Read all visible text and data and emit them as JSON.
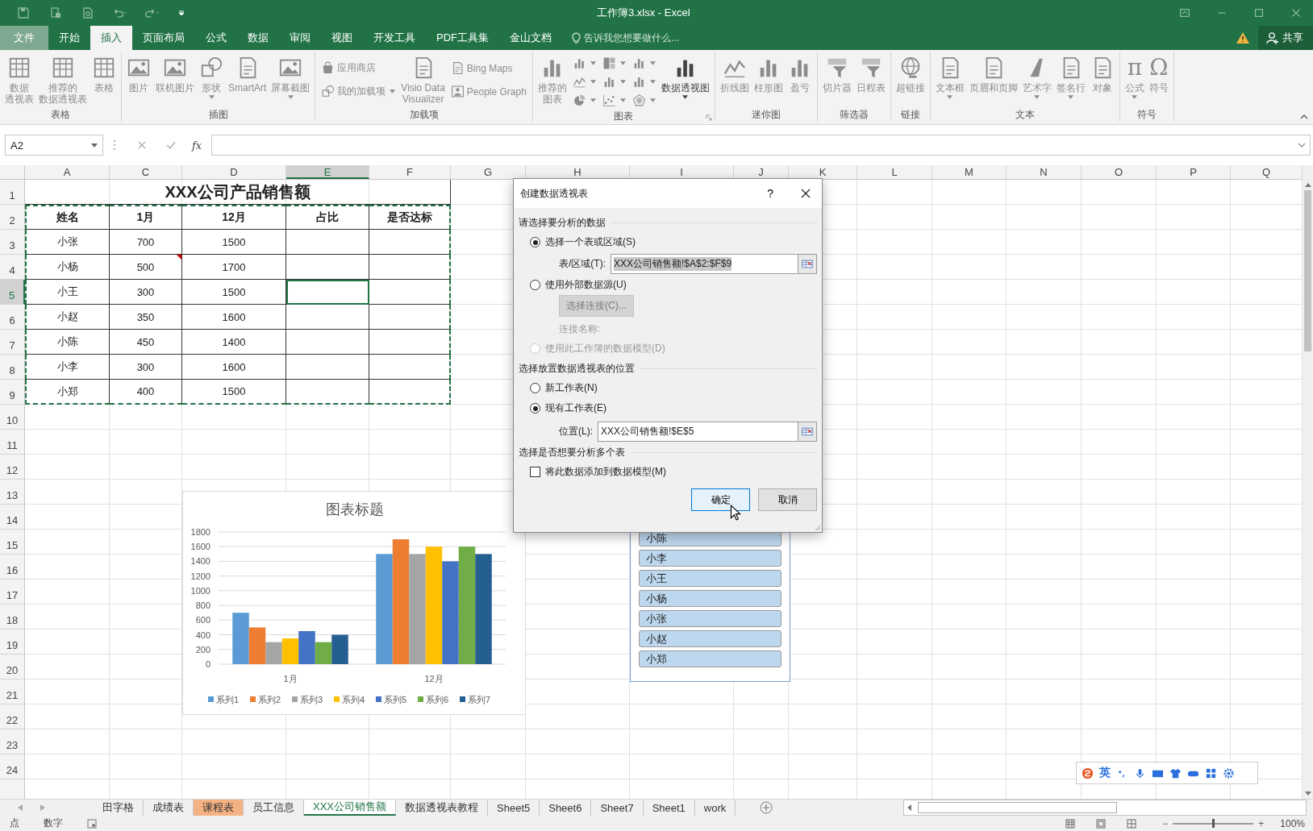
{
  "window": {
    "title": "工作簿3.xlsx - Excel"
  },
  "ribbon_tabs": [
    {
      "label": "文件",
      "kind": "file",
      "selected": false
    },
    {
      "label": "开始",
      "kind": "tab",
      "selected": false
    },
    {
      "label": "插入",
      "kind": "tab",
      "selected": true
    },
    {
      "label": "页面布局",
      "kind": "tab",
      "selected": false
    },
    {
      "label": "公式",
      "kind": "tab",
      "selected": false
    },
    {
      "label": "数据",
      "kind": "tab",
      "selected": false
    },
    {
      "label": "审阅",
      "kind": "tab",
      "selected": false
    },
    {
      "label": "视图",
      "kind": "tab",
      "selected": false
    },
    {
      "label": "开发工具",
      "kind": "tab",
      "selected": false
    },
    {
      "label": "PDF工具集",
      "kind": "tab",
      "selected": false
    },
    {
      "label": "金山文档",
      "kind": "tab",
      "selected": false
    }
  ],
  "tell_me": {
    "placeholder": "告诉我您想要做什么..."
  },
  "share_button": "共享",
  "ribbon_groups": [
    {
      "label": "表格",
      "launcher": false,
      "buttons": [
        {
          "label": [
            "数据",
            "透视表"
          ],
          "kind": "large",
          "disabled": true,
          "dropdown": false
        },
        {
          "label": [
            "推荐的",
            "数据透视表"
          ],
          "kind": "large",
          "disabled": true,
          "dropdown": false
        },
        {
          "label": "表格",
          "kind": "large",
          "disabled": true,
          "dropdown": false
        }
      ]
    },
    {
      "label": "插图",
      "launcher": false,
      "buttons": [
        {
          "label": "图片",
          "kind": "large",
          "disabled": true,
          "dropdown": false
        },
        {
          "label": "联机图片",
          "kind": "large",
          "disabled": true,
          "dropdown": false
        },
        {
          "label": "形状",
          "kind": "large",
          "disabled": true,
          "dropdown": true
        },
        {
          "label": "SmartArt",
          "kind": "large",
          "disabled": true,
          "dropdown": false
        },
        {
          "label": "屏幕截图",
          "kind": "large",
          "disabled": true,
          "dropdown": true
        }
      ]
    },
    {
      "label": "加载项",
      "launcher": false,
      "buttons": [
        {
          "label": "应用商店",
          "kind": "small",
          "disabled": true,
          "dropdown": false
        },
        {
          "label": "我的加载项",
          "kind": "small",
          "disabled": true,
          "dropdown": true
        },
        {
          "label": [
            "Visio Data",
            "Visualizer"
          ],
          "kind": "large",
          "disabled": true,
          "dropdown": false
        },
        {
          "label": "Bing Maps",
          "kind": "small",
          "disabled": true,
          "dropdown": false
        },
        {
          "label": "People Graph",
          "kind": "small",
          "disabled": true,
          "dropdown": false
        }
      ]
    },
    {
      "label": "图表",
      "launcher": true,
      "buttons": [
        {
          "label": [
            "推荐的",
            "图表"
          ],
          "kind": "large",
          "disabled": true,
          "dropdown": false
        },
        {
          "kind": "icon",
          "disabled": true,
          "dropdown": true
        },
        {
          "kind": "icon",
          "disabled": true,
          "dropdown": true
        },
        {
          "kind": "icon",
          "disabled": true,
          "dropdown": true
        },
        {
          "kind": "icon",
          "disabled": true,
          "dropdown": true
        },
        {
          "kind": "icon",
          "disabled": true,
          "dropdown": true
        },
        {
          "kind": "icon",
          "disabled": true,
          "dropdown": true
        },
        {
          "kind": "icon",
          "disabled": true,
          "dropdown": true
        },
        {
          "kind": "icon",
          "disabled": true,
          "dropdown": true
        },
        {
          "kind": "icon",
          "disabled": true,
          "dropdown": true
        },
        {
          "label": "数据透视图",
          "kind": "large",
          "disabled": false,
          "dropdown": true
        }
      ]
    },
    {
      "label": "迷你图",
      "launcher": false,
      "buttons": [
        {
          "label": "折线图",
          "kind": "large",
          "disabled": true,
          "dropdown": false
        },
        {
          "label": "柱形图",
          "kind": "large",
          "disabled": true,
          "dropdown": false
        },
        {
          "label": "盈亏",
          "kind": "large",
          "disabled": true,
          "dropdown": false
        }
      ]
    },
    {
      "label": "筛选器",
      "launcher": false,
      "buttons": [
        {
          "label": "切片器",
          "kind": "large",
          "disabled": true,
          "dropdown": false
        },
        {
          "label": "日程表",
          "kind": "large",
          "disabled": true,
          "dropdown": false
        }
      ]
    },
    {
      "label": "链接",
      "launcher": false,
      "buttons": [
        {
          "label": "超链接",
          "kind": "large",
          "disabled": true,
          "dropdown": false
        }
      ]
    },
    {
      "label": "文本",
      "launcher": false,
      "buttons": [
        {
          "label": "文本框",
          "kind": "large",
          "disabled": true,
          "dropdown": true
        },
        {
          "label": "页眉和页脚",
          "kind": "large",
          "disabled": true,
          "dropdown": false
        },
        {
          "label": "艺术字",
          "kind": "large",
          "disabled": true,
          "dropdown": true
        },
        {
          "label": "签名行",
          "kind": "large",
          "disabled": true,
          "dropdown": true
        },
        {
          "label": "对象",
          "kind": "large",
          "disabled": true,
          "dropdown": false
        }
      ]
    },
    {
      "label": "符号",
      "launcher": false,
      "buttons": [
        {
          "label": "公式",
          "kind": "large",
          "glyph": "π",
          "disabled": true,
          "dropdown": true
        },
        {
          "label": "符号",
          "kind": "large",
          "glyph": "Ω",
          "disabled": true,
          "dropdown": false
        }
      ]
    }
  ],
  "formula_bar": {
    "name_box": "A2",
    "fx": "fx"
  },
  "sheet": {
    "columns": [
      {
        "label": "A",
        "selected": false
      },
      {
        "label": "C",
        "selected": false
      },
      {
        "label": "D",
        "selected": false
      },
      {
        "label": "E",
        "selected": true
      },
      {
        "label": "F",
        "selected": false
      },
      {
        "label": "G",
        "selected": false
      },
      {
        "label": "H",
        "selected": false
      },
      {
        "label": "I",
        "selected": false
      },
      {
        "label": "J",
        "selected": false
      },
      {
        "label": "K",
        "selected": false
      },
      {
        "label": "L",
        "selected": false
      },
      {
        "label": "M",
        "selected": false
      },
      {
        "label": "N",
        "selected": false
      },
      {
        "label": "O",
        "selected": false
      },
      {
        "label": "P",
        "selected": false
      },
      {
        "label": "Q",
        "selected": false
      }
    ],
    "row_numbers": [
      {
        "label": "1",
        "selected": false
      },
      {
        "label": "2",
        "selected": false
      },
      {
        "label": "3",
        "selected": false
      },
      {
        "label": "4",
        "selected": false
      },
      {
        "label": "5",
        "selected": true
      },
      {
        "label": "6",
        "selected": false
      },
      {
        "label": "7",
        "selected": false
      },
      {
        "label": "8",
        "selected": false
      },
      {
        "label": "9",
        "selected": false
      },
      {
        "label": "10",
        "selected": false
      },
      {
        "label": "11",
        "selected": false
      },
      {
        "label": "12",
        "selected": false
      },
      {
        "label": "13",
        "selected": false
      },
      {
        "label": "14",
        "selected": false
      },
      {
        "label": "15",
        "selected": false
      },
      {
        "label": "16",
        "selected": false
      },
      {
        "label": "17",
        "selected": false
      },
      {
        "label": "18",
        "selected": false
      },
      {
        "label": "19",
        "selected": false
      },
      {
        "label": "20",
        "selected": false
      },
      {
        "label": "21",
        "selected": false
      },
      {
        "label": "22",
        "selected": false
      },
      {
        "label": "23",
        "selected": false
      },
      {
        "label": "24",
        "selected": false
      }
    ],
    "title": "XXX公司产品销售额",
    "header": [
      "姓名",
      "1月",
      "12月",
      "占比",
      "是否达标"
    ],
    "rows": [
      {
        "cells": [
          "小张",
          "700",
          "1500"
        ],
        "comment": false
      },
      {
        "cells": [
          "小杨",
          "500",
          "1700"
        ],
        "comment": true
      },
      {
        "cells": [
          "小王",
          "300",
          "1500"
        ],
        "comment": false
      },
      {
        "cells": [
          "小赵",
          "350",
          "1600"
        ],
        "comment": false
      },
      {
        "cells": [
          "小陈",
          "450",
          "1400"
        ],
        "comment": false
      },
      {
        "cells": [
          "小李",
          "300",
          "1600"
        ],
        "comment": false
      },
      {
        "cells": [
          "小郑",
          "400",
          "1500"
        ],
        "comment": false
      }
    ]
  },
  "chart": {
    "chart_data": {
      "type": "bar",
      "title": "图表标题",
      "categories": [
        "1月",
        "12月"
      ],
      "series": [
        {
          "name": "系列1",
          "color": "#5b9bd5",
          "values": [
            700,
            1500
          ]
        },
        {
          "name": "系列2",
          "color": "#ed7d31",
          "values": [
            500,
            1700
          ]
        },
        {
          "name": "系列3",
          "color": "#a5a5a5",
          "values": [
            300,
            1500
          ]
        },
        {
          "name": "系列4",
          "color": "#ffc000",
          "values": [
            350,
            1600
          ]
        },
        {
          "name": "系列5",
          "color": "#4472c4",
          "values": [
            450,
            1400
          ]
        },
        {
          "name": "系列6",
          "color": "#70ad47",
          "values": [
            300,
            1600
          ]
        },
        {
          "name": "系列7",
          "color": "#255e91",
          "values": [
            400,
            1500
          ]
        }
      ],
      "grid": true,
      "legend": true,
      "ylim": [
        0,
        1800
      ],
      "yticks": [
        0,
        200,
        400,
        600,
        800,
        1000,
        1200,
        1400,
        1600,
        1800
      ]
    }
  },
  "slicer": {
    "items": [
      {
        "label": "小陈",
        "selected": true
      },
      {
        "label": "小李",
        "selected": true
      },
      {
        "label": "小王",
        "selected": true
      },
      {
        "label": "小杨",
        "selected": true
      },
      {
        "label": "小张",
        "selected": true
      },
      {
        "label": "小赵",
        "selected": true
      },
      {
        "label": "小郑",
        "selected": true
      }
    ]
  },
  "dialog": {
    "title": "创建数据透视表",
    "help": "?",
    "source_heading": "请选择要分析的数据",
    "source_options": [
      {
        "label": "选择一个表或区域(S)",
        "selected": true,
        "disabled": false
      },
      {
        "label": "使用外部数据源(U)",
        "selected": false,
        "disabled": false
      },
      {
        "label": "使用此工作簿的数据模型(D)",
        "selected": false,
        "disabled": true
      }
    ],
    "range_field": {
      "label": "表/区域(T):",
      "value": "XXX公司销售额!$A$2:$F$9",
      "text_selected": true
    },
    "connection_button": {
      "label": "选择连接(C)...",
      "disabled": true
    },
    "connection_name": "连接名称:",
    "location_heading": "选择放置数据透视表的位置",
    "location_options": [
      {
        "label": "新工作表(N)",
        "selected": false,
        "disabled": false
      },
      {
        "label": "现有工作表(E)",
        "selected": true,
        "disabled": false
      }
    ],
    "location_field": {
      "label": "位置(L):",
      "value": "XXX公司销售额!$E$5",
      "text_selected": false
    },
    "multi_heading": "选择是否想要分析多个表",
    "model_checkbox": {
      "label": "将此数据添加到数据模型(M)",
      "checked": false
    },
    "buttons": [
      {
        "label": "确定",
        "default": true
      },
      {
        "label": "取消",
        "default": false
      }
    ]
  },
  "ime": {
    "mode": "英"
  },
  "sheet_tabs": [
    {
      "label": "田字格",
      "selected": false
    },
    {
      "label": "成绩表",
      "selected": false
    },
    {
      "label": "课程表",
      "selected": false,
      "color": "#f4b183"
    },
    {
      "label": "员工信息",
      "selected": false
    },
    {
      "label": "XXX公司销售额",
      "selected": true
    },
    {
      "label": "数据透视表教程",
      "selected": false
    },
    {
      "label": "Sheet5",
      "selected": false
    },
    {
      "label": "Sheet6",
      "selected": false
    },
    {
      "label": "Sheet7",
      "selected": false
    },
    {
      "label": "Sheet1",
      "selected": false
    },
    {
      "label": "work",
      "selected": false
    }
  ],
  "status_bar": {
    "mode": "点",
    "num_lock": "数字",
    "zoom_out": "−",
    "zoom_in": "+",
    "zoom": "100%",
    "level": 0.5
  }
}
